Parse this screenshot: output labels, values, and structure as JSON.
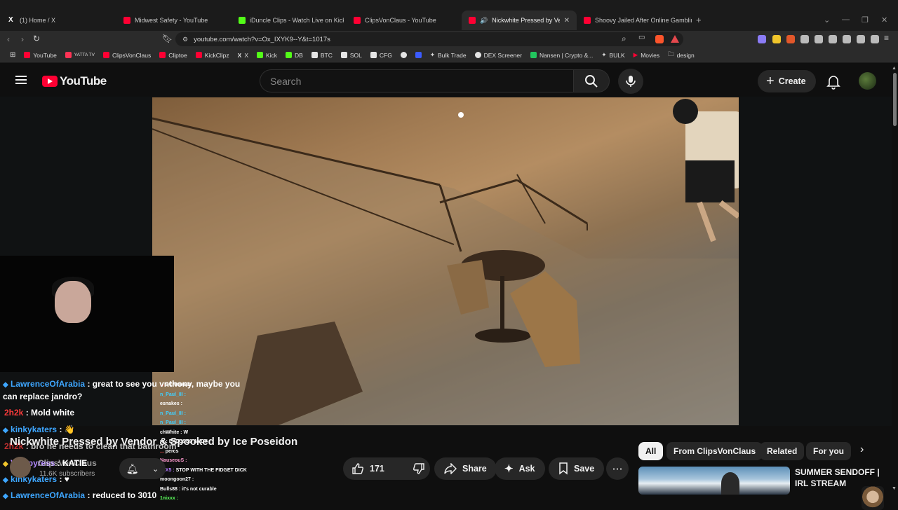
{
  "browser": {
    "tabs": [
      {
        "label": "(1) Home / X",
        "color": "#ffffff"
      },
      {
        "label": "Midwest Safety - YouTube",
        "color": "#ff0033"
      },
      {
        "label": "iDuncle Clips - Watch Live on Kick",
        "color": "#53fc18"
      },
      {
        "label": "ClipsVonClaus - YouTube",
        "color": "#ff0033"
      },
      {
        "label": "Nickwhite Pressed by Vendor",
        "color": "#ff0033"
      },
      {
        "label": "Shoovy Jailed After Online Gambling",
        "color": "#ff0033"
      }
    ],
    "active_tab_close": "✕",
    "new_tab": "+",
    "url": "youtube.com/watch?v=Ox_IXYK9--Y&t=1017s",
    "bookmarks": [
      {
        "label": "YouTube",
        "color": "#ff0033"
      },
      {
        "label": "YATTA TV",
        "color": "#ff3355"
      },
      {
        "label": "ClipsVonClaus",
        "color": "#ff0033"
      },
      {
        "label": "Cliptoe",
        "color": "#ff0033"
      },
      {
        "label": "KickClipz",
        "color": "#ff0033"
      },
      {
        "label": "X",
        "color": "#e5e5e5"
      },
      {
        "label": "Kick",
        "color": "#53fc18"
      },
      {
        "label": "DB",
        "color": "#53fc18"
      },
      {
        "label": "BTC",
        "color": "#e5e5e5"
      },
      {
        "label": "SOL",
        "color": "#e5e5e5"
      },
      {
        "label": "CFG",
        "color": "#e5e5e5"
      },
      {
        "label": "",
        "color": "#e5e5e5"
      },
      {
        "label": "",
        "color": "#3b5bff"
      },
      {
        "label": "Bulk Trade",
        "color": "#e5e5e5"
      },
      {
        "label": "DEX Screener",
        "color": "#e5e5e5"
      },
      {
        "label": "Nansen | Crypto &...",
        "color": "#22c55e"
      },
      {
        "label": "BULK",
        "color": "#e5e5e5"
      },
      {
        "label": "Movies",
        "color": "#ff0033"
      },
      {
        "label": "design",
        "color": "#c8c8c8"
      }
    ]
  },
  "youtube": {
    "logo_text": "YouTube",
    "search_placeholder": "Search",
    "create_label": "Create"
  },
  "stream_overlay": {
    "chat": [
      {
        "user": "...",
        "text": "SCAMMED",
        "color": "#ff4d4d"
      },
      {
        "user": "n_Paul_III :",
        "text": "",
        "color": "#3fd0ff"
      },
      {
        "user": "esnakes :",
        "text": "",
        "color": "#ffffff"
      },
      {
        "user": "n_Paul_III :",
        "text": "",
        "color": "#3fd0ff"
      },
      {
        "user": "n_Paul_III :",
        "text": "",
        "color": "#3fd0ff"
      },
      {
        "user": "chWhite :",
        "text": "W",
        "color": "#ffffff"
      },
      {
        "user": "rs :",
        "text": "EXCUSES ANDY",
        "color": "#ffffff"
      },
      {
        "user": "...",
        "text": "percs",
        "color": "#ff4d4d"
      },
      {
        "user": "NauseouS :",
        "text": "",
        "color": "#ff9bd0"
      },
      {
        "user": "J3X5 :",
        "text": "STOP WITH THE FIDGET DICK",
        "color": "#b37aff"
      },
      {
        "user": "moongoon27 :",
        "text": "",
        "color": "#ffffff"
      },
      {
        "user": "Bulls88 :",
        "text": "it's not curable",
        "color": "#ffffff"
      },
      {
        "user": "1nixxx :",
        "text": "",
        "color": "#5cff5c"
      }
    ]
  },
  "live_chat": [
    {
      "name": "LawrenceOfArabia",
      "text": ": great to see you vnthony, maybe you",
      "color": "#3ea6ff"
    },
    {
      "name": "",
      "text": "can replace jandro?",
      "color": "#ffffff"
    },
    {
      "name": "2h2k",
      "text": ": Mold white",
      "color": "#ff3b3b"
    },
    {
      "name": "kinkykaters",
      "text": ":",
      "color": "#3ea6ff"
    },
    {
      "name": "2h2k",
      "text": ": bro he needs to clean that bathroom",
      "color": "#ff3b3b"
    },
    {
      "name": "Vampyress",
      "text": ": KATIE",
      "color": "#b388ff"
    },
    {
      "name": "kinkykaters",
      "text": ":",
      "color": "#3ea6ff"
    },
    {
      "name": "LawrenceOfArabia",
      "text": ": reduced to 3010",
      "color": "#3ea6ff"
    }
  ],
  "video": {
    "title": "Nickwhite Pressed by Vendor & Spooked by Ice Poseidon",
    "channel": "ClipsVonClaus",
    "subscribers": "11.6K subscribers",
    "likes": "171",
    "share_label": "Share",
    "ask_label": "Ask",
    "save_label": "Save"
  },
  "chips": [
    "All",
    "From ClipsVonClaus",
    "Related",
    "For you"
  ],
  "recommended": {
    "title_line1": "SUMMER SENDOFF |",
    "title_line2": "IRL STREAM"
  }
}
